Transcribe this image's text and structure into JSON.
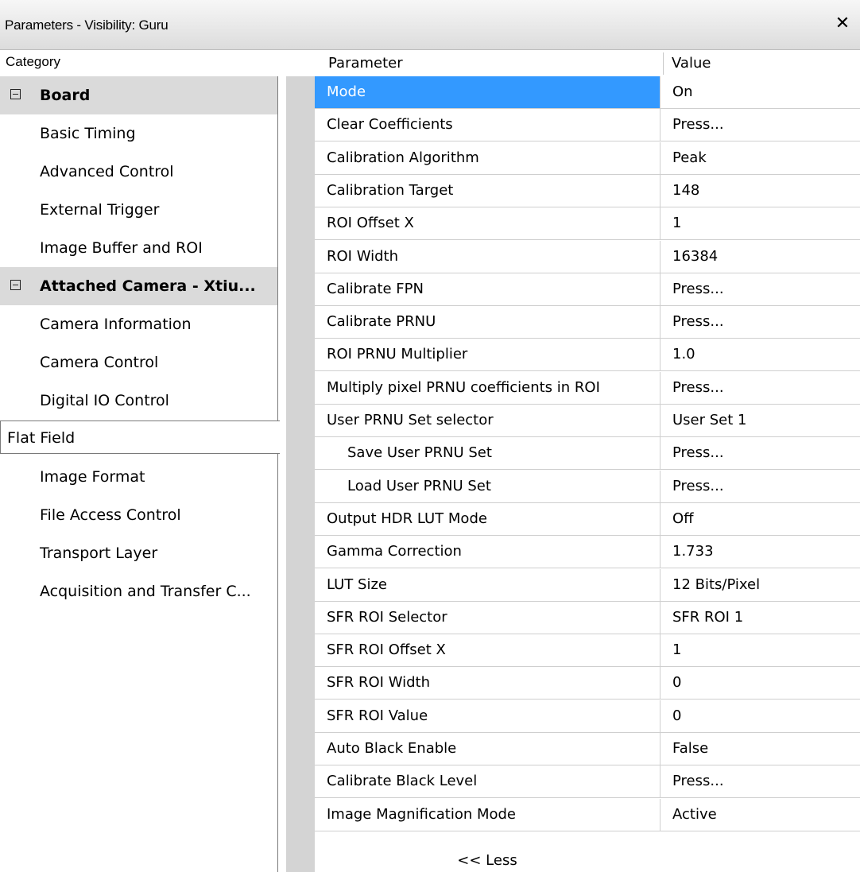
{
  "window": {
    "title": "Parameters - Visibility: Guru",
    "close_glyph": "✕"
  },
  "headers": {
    "category": "Category",
    "parameter": "Parameter",
    "value": "Value"
  },
  "categories": [
    {
      "label": "Board",
      "type": "group",
      "expanded": true
    },
    {
      "label": "Basic Timing",
      "type": "item"
    },
    {
      "label": "Advanced Control",
      "type": "item"
    },
    {
      "label": "External Trigger",
      "type": "item"
    },
    {
      "label": "Image Buffer and ROI",
      "type": "item"
    },
    {
      "label": "Attached Camera - Xtiu...",
      "type": "group",
      "expanded": true
    },
    {
      "label": "Camera Information",
      "type": "item"
    },
    {
      "label": "Camera Control",
      "type": "item"
    },
    {
      "label": "Digital IO Control",
      "type": "item"
    },
    {
      "label": "Flat Field",
      "type": "item",
      "selected": true
    },
    {
      "label": "Image Format",
      "type": "item"
    },
    {
      "label": "File Access Control",
      "type": "item"
    },
    {
      "label": "Transport Layer",
      "type": "item"
    },
    {
      "label": "Acquisition and Transfer C...",
      "type": "item"
    }
  ],
  "parameters": [
    {
      "name": "Mode",
      "value": "On",
      "selected": true
    },
    {
      "name": "Clear Coefficients",
      "value": "Press..."
    },
    {
      "name": "Calibration Algorithm",
      "value": "Peak"
    },
    {
      "name": "Calibration Target",
      "value": "148"
    },
    {
      "name": "ROI Offset X",
      "value": "1"
    },
    {
      "name": "ROI Width",
      "value": "16384"
    },
    {
      "name": "Calibrate FPN",
      "value": "Press..."
    },
    {
      "name": "Calibrate PRNU",
      "value": "Press..."
    },
    {
      "name": "ROI PRNU Multiplier",
      "value": "1.0"
    },
    {
      "name": "Multiply pixel PRNU coefficients in ROI",
      "value": "Press..."
    },
    {
      "name": "User PRNU Set selector",
      "value": "User Set 1"
    },
    {
      "name": "Save User PRNU Set",
      "value": "Press...",
      "indent": true
    },
    {
      "name": "Load User PRNU Set",
      "value": "Press...",
      "indent": true
    },
    {
      "name": "Output HDR LUT Mode",
      "value": "Off"
    },
    {
      "name": "Gamma Correction",
      "value": "1.733"
    },
    {
      "name": "LUT Size",
      "value": "12 Bits/Pixel"
    },
    {
      "name": "SFR ROI Selector",
      "value": "SFR ROI 1"
    },
    {
      "name": "SFR ROI Offset X",
      "value": "1"
    },
    {
      "name": "SFR ROI Width",
      "value": "0"
    },
    {
      "name": "SFR ROI Value",
      "value": "0"
    },
    {
      "name": "Auto Black Enable",
      "value": "False"
    },
    {
      "name": "Calibrate Black Level",
      "value": "Press..."
    },
    {
      "name": "Image Magnification Mode",
      "value": "Active"
    }
  ],
  "footer": {
    "less_label": "<< Less"
  }
}
